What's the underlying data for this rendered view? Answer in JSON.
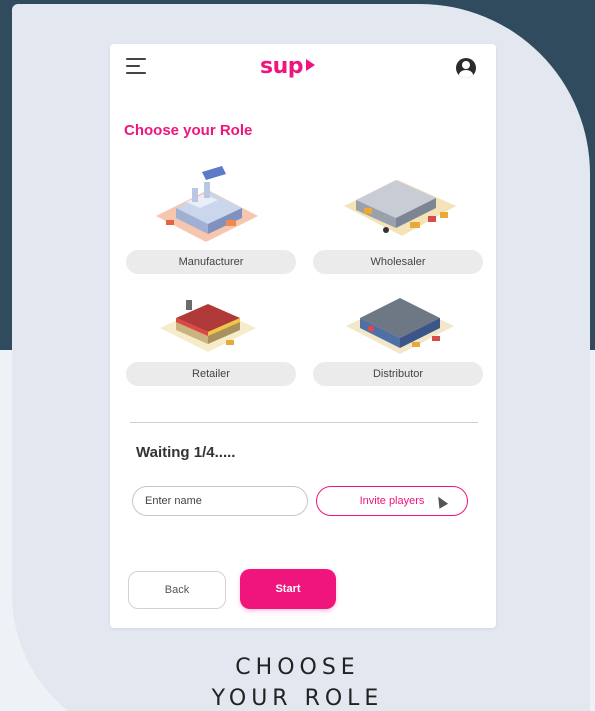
{
  "app": {
    "logo_text": "sup",
    "brand_color": "#f0157d"
  },
  "header": {
    "menu_icon": "hamburger-menu-icon",
    "profile_icon": "user-profile-icon"
  },
  "page": {
    "title": "Choose your Role"
  },
  "roles": [
    {
      "label": "Manufacturer",
      "icon": "factory-illustration"
    },
    {
      "label": "Wholesaler",
      "icon": "warehouse-illustration"
    },
    {
      "label": "Retailer",
      "icon": "store-illustration"
    },
    {
      "label": "Distributor",
      "icon": "distribution-center-illustration"
    }
  ],
  "lobby": {
    "waiting_text": "Waiting 1/4.....",
    "name_placeholder": "Enter name",
    "invite_label": "Invite players"
  },
  "actions": {
    "back_label": "Back",
    "start_label": "Start"
  },
  "caption": {
    "line1": "CHOOSE",
    "line2": "YOUR ROLE"
  }
}
